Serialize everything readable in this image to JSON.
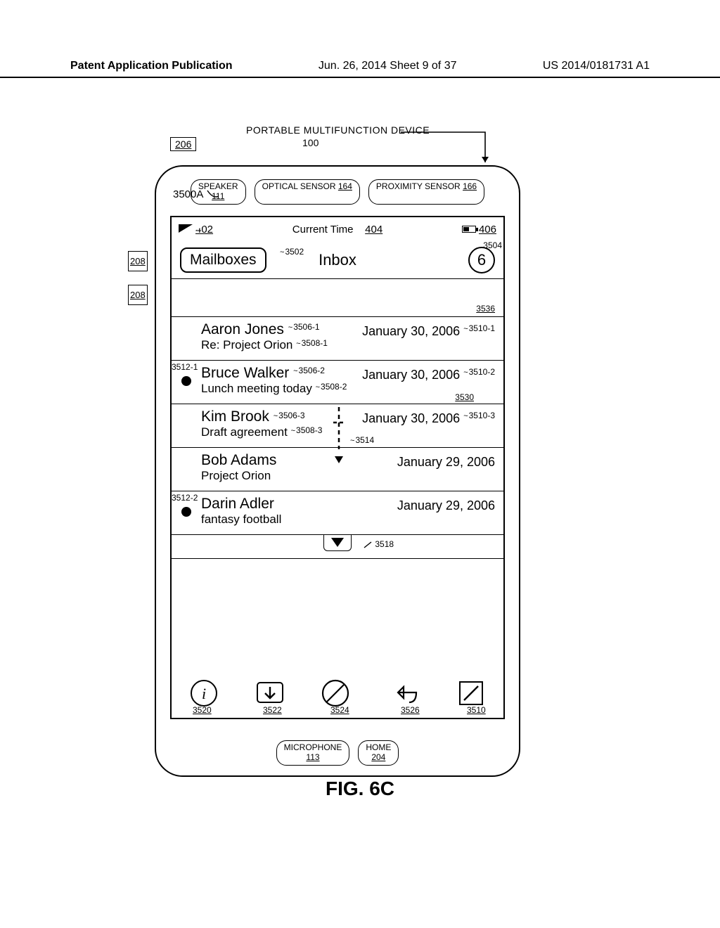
{
  "header": {
    "left": "Patent Application Publication",
    "center": "Jun. 26, 2014  Sheet 9 of 37",
    "right": "US 2014/0181731 A1"
  },
  "top": {
    "ref_206": "206",
    "pmd": "PORTABLE MULTIFUNCTION DEVICE",
    "ref_100": "100"
  },
  "side_208": "208",
  "sensors": {
    "speaker_label": "SPEAKER",
    "speaker_num": "111",
    "optical_label": "OPTICAL SENSOR",
    "optical_num": "164",
    "prox_label": "PROXIMITY SENSOR",
    "prox_num": "166"
  },
  "ref_3500A": "3500A",
  "status": {
    "ref_402": "402",
    "current_time": "Current Time",
    "ref_404": "404",
    "ref_406": "406"
  },
  "nav": {
    "mailboxes": "Mailboxes",
    "ref_3502": "3502",
    "title": "Inbox",
    "count": "6",
    "ref_3504": "3504"
  },
  "blank_ref": "3536",
  "rows": [
    {
      "sender": "Aaron Jones",
      "subject": "Re: Project Orion",
      "date": "January 30, 2006",
      "ref_sender": "3506-1",
      "ref_subject": "3508-1",
      "ref_date": "3510-1",
      "unread": false,
      "ref_unread": null
    },
    {
      "sender": "Bruce Walker",
      "subject": "Lunch meeting today",
      "date": "January 30, 2006",
      "ref_sender": "3506-2",
      "ref_subject": "3508-2",
      "ref_date": "3510-2",
      "unread": true,
      "ref_unread": "3512-1",
      "ref_row": "3530"
    },
    {
      "sender": "Kim Brook",
      "subject": "Draft agreement",
      "date": "January 30, 2006",
      "ref_sender": "3506-3",
      "ref_subject": "3508-3",
      "ref_date": "3510-3",
      "unread": false,
      "ref_cursor": "3514"
    },
    {
      "sender": "Bob Adams",
      "subject": "Project Orion",
      "date": "January 29, 2006",
      "unread": false
    },
    {
      "sender": "Darin Adler",
      "subject": "fantasy football",
      "date": "January 29, 2006",
      "unread": true,
      "ref_unread": "3512-2"
    }
  ],
  "triangle_ref": "3518",
  "toolbar_refs": {
    "info": "3520",
    "inbox": "3522",
    "block": "3524",
    "reply": "3526",
    "compose": "3510"
  },
  "bottom": {
    "mic_label": "MICROPHONE",
    "mic_num": "113",
    "home_label": "HOME",
    "home_num": "204"
  },
  "figure_label": "FIG. 6C"
}
